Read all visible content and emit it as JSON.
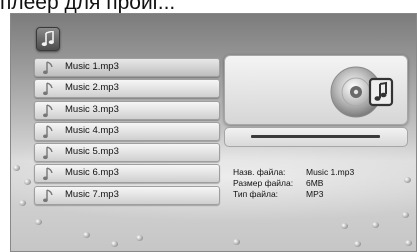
{
  "caption": "плеер для проиг...",
  "playlist": {
    "items": [
      {
        "label": "Music 1.mp3"
      },
      {
        "label": "Music 2.mp3"
      },
      {
        "label": "Music 3.mp3"
      },
      {
        "label": "Music 4.mp3"
      },
      {
        "label": "Music 5.mp3"
      },
      {
        "label": "Music 6.mp3"
      },
      {
        "label": "Music 7.mp3"
      }
    ],
    "selected_index": 0
  },
  "progress": {
    "value": 0
  },
  "file_info": {
    "name_label": "Назв. файла:",
    "name_value": "Music 1.mp3",
    "size_label": "Размер файла:",
    "size_value": "6MB",
    "type_label": "Тип файла:",
    "type_value": "MP3"
  },
  "icons": {
    "app": "music-note-icon",
    "item": "music-note-icon",
    "cover": "cd-music-icon"
  },
  "colors": {
    "background_top": "#7c7c7c",
    "background_bottom": "#d0d0d0",
    "item_face": "#e3e3e3"
  }
}
